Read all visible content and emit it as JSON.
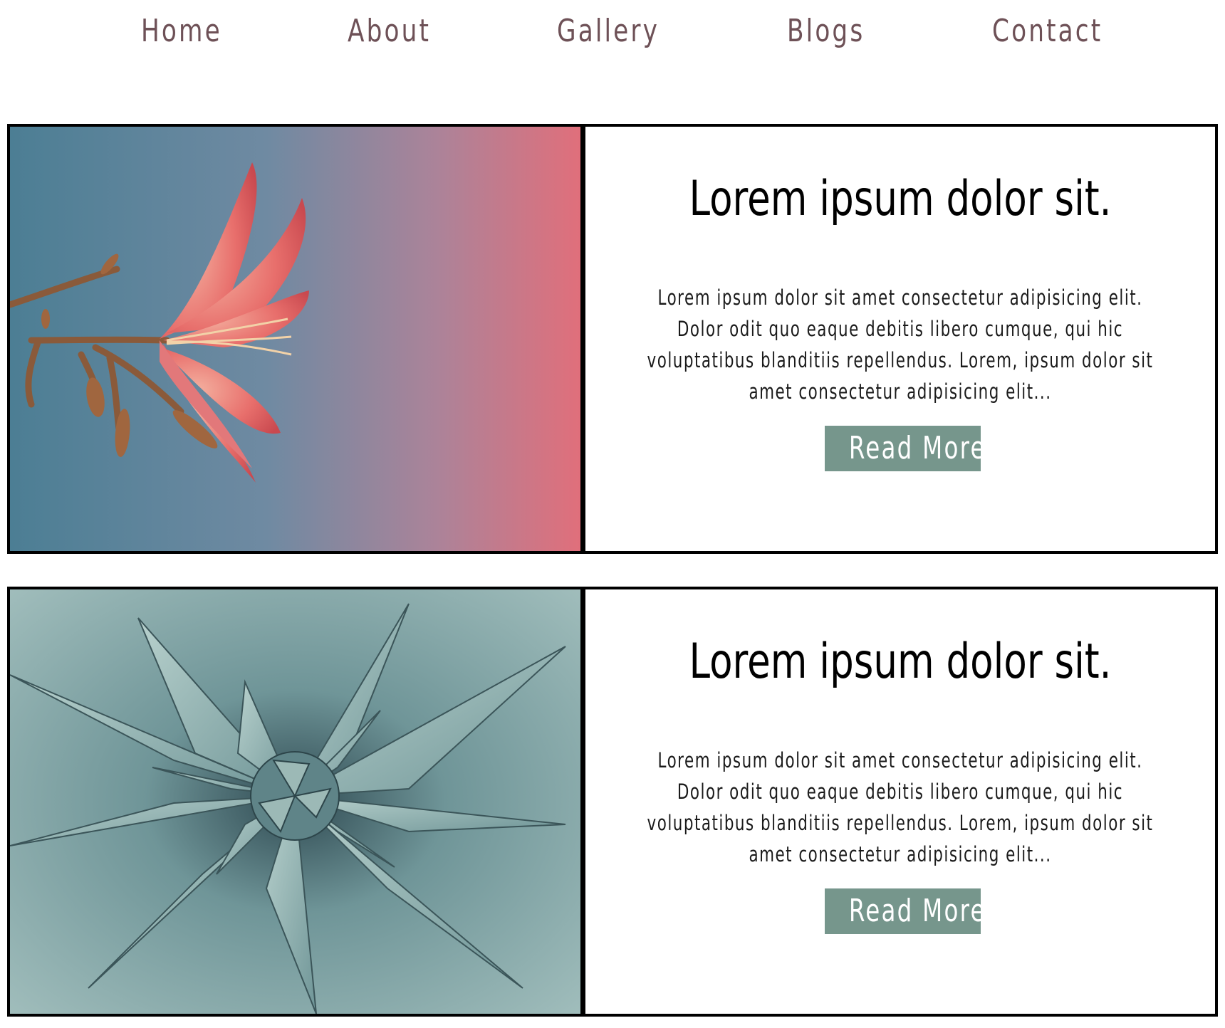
{
  "nav": {
    "items": [
      {
        "label": "Home"
      },
      {
        "label": "About"
      },
      {
        "label": "Gallery"
      },
      {
        "label": "Blogs"
      },
      {
        "label": "Contact"
      }
    ]
  },
  "posts": [
    {
      "title": "Lorem ipsum dolor sit.",
      "excerpt": "Lorem ipsum dolor sit amet consectetur adipisicing elit. Dolor odit quo eaque debitis libero cumque, qui hic voluptatibus blanditiis repellendus. Lorem, ipsum dolor sit amet consectetur adipisicing elit...",
      "button_label": "Read More",
      "image": "pink-lily-flower"
    },
    {
      "title": "Lorem ipsum dolor sit.",
      "excerpt": "Lorem ipsum dolor sit amet consectetur adipisicing elit. Dolor odit quo eaque debitis libero cumque, qui hic voluptatibus blanditiis repellendus. Lorem, ipsum dolor sit amet consectetur adipisicing elit...",
      "button_label": "Read More",
      "image": "agave-succulent"
    }
  ],
  "colors": {
    "nav_text": "#6e5157",
    "button_bg": "#76968c",
    "button_text": "#ffffff",
    "border": "#000000"
  }
}
